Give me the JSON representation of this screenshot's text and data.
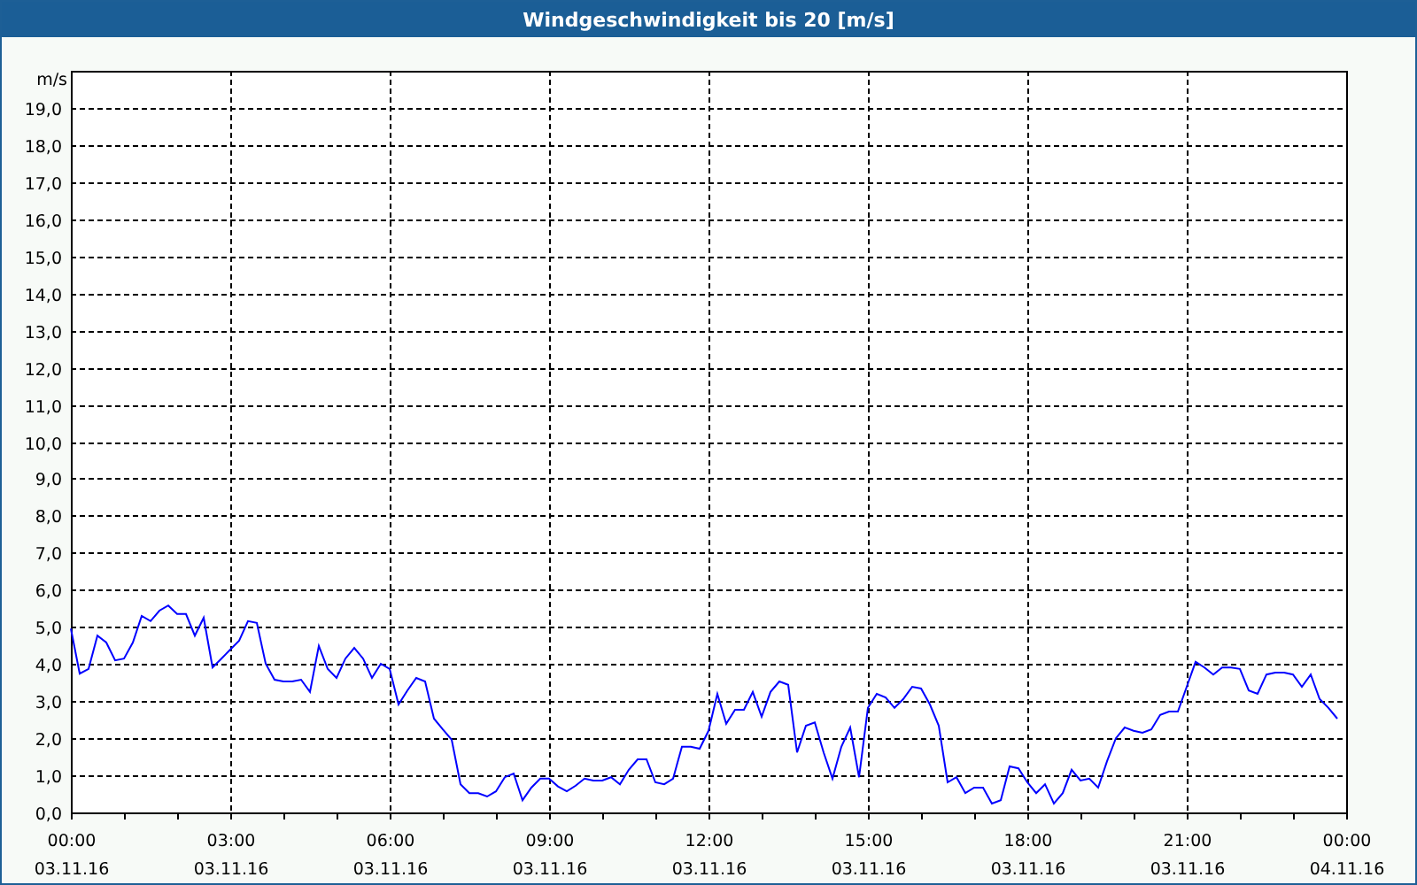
{
  "window": {
    "title": "Windgeschwindigkeit bis 20 [m/s]"
  },
  "chart": {
    "chart_data": {
      "type": "line",
      "grid": true,
      "ylabel": "m/s",
      "ylim": [
        0,
        20
      ],
      "yticks": [
        {
          "value": 0,
          "label": "0,0"
        },
        {
          "value": 1,
          "label": "1,0"
        },
        {
          "value": 2,
          "label": "2,0"
        },
        {
          "value": 3,
          "label": "3,0"
        },
        {
          "value": 4,
          "label": "4,0"
        },
        {
          "value": 5,
          "label": "5,0"
        },
        {
          "value": 6,
          "label": "6,0"
        },
        {
          "value": 7,
          "label": "7,0"
        },
        {
          "value": 8,
          "label": "8,0"
        },
        {
          "value": 9,
          "label": "9,0"
        },
        {
          "value": 10,
          "label": "10,0"
        },
        {
          "value": 11,
          "label": "11,0"
        },
        {
          "value": 12,
          "label": "12,0"
        },
        {
          "value": 13,
          "label": "13,0"
        },
        {
          "value": 14,
          "label": "14,0"
        },
        {
          "value": 15,
          "label": "15,0"
        },
        {
          "value": 16,
          "label": "16,0"
        },
        {
          "value": 17,
          "label": "17,0"
        },
        {
          "value": 18,
          "label": "18,0"
        },
        {
          "value": 19,
          "label": "19,0"
        }
      ],
      "categories": [
        "00:00\n03.11.16",
        null,
        null,
        null,
        null,
        null,
        null,
        null,
        null,
        null,
        null,
        null,
        null,
        null,
        null,
        null,
        null,
        null,
        "03:00\n03.11.16",
        null,
        null,
        null,
        null,
        null,
        null,
        null,
        null,
        null,
        null,
        null,
        null,
        null,
        null,
        null,
        null,
        null,
        "06:00\n03.11.16",
        null,
        null,
        null,
        null,
        null,
        null,
        null,
        null,
        null,
        null,
        null,
        null,
        null,
        null,
        null,
        null,
        null,
        "09:00\n03.11.16",
        null,
        null,
        null,
        null,
        null,
        null,
        null,
        null,
        null,
        null,
        null,
        null,
        null,
        null,
        null,
        null,
        null,
        "12:00\n03.11.16",
        null,
        null,
        null,
        null,
        null,
        null,
        null,
        null,
        null,
        null,
        null,
        null,
        null,
        null,
        null,
        null,
        null,
        "15:00\n03.11.16",
        null,
        null,
        null,
        null,
        null,
        null,
        null,
        null,
        null,
        null,
        null,
        null,
        null,
        null,
        null,
        null,
        null,
        "18:00\n03.11.16",
        null,
        null,
        null,
        null,
        null,
        null,
        null,
        null,
        null,
        null,
        null,
        null,
        null,
        null,
        null,
        null,
        null,
        "21:00\n03.11.16",
        null,
        null,
        null,
        null,
        null,
        null,
        null,
        null,
        null,
        null,
        null,
        null,
        null,
        null,
        null,
        null,
        null,
        "00:00\n04.11.16"
      ],
      "series": [
        {
          "color": "#0000ff",
          "values": [
            4.96,
            3.74,
            3.87,
            4.77,
            4.58,
            4.1,
            4.15,
            4.58,
            5.3,
            5.16,
            5.44,
            5.58,
            5.35,
            5.35,
            4.77,
            5.25,
            3.91,
            4.15,
            4.39,
            4.63,
            5.16,
            5.11,
            4.01,
            3.58,
            3.53,
            3.53,
            3.58,
            3.25,
            4.49,
            3.87,
            3.63,
            4.15,
            4.44,
            4.15,
            3.63,
            4.01,
            3.87,
            2.91,
            3.29,
            3.63,
            3.53,
            2.53,
            2.24,
            1.96,
            0.76,
            0.52,
            0.52,
            0.43,
            0.57,
            0.95,
            1.05,
            0.33,
            0.67,
            0.91,
            0.91,
            0.7,
            0.57,
            0.72,
            0.91,
            0.86,
            0.86,
            0.95,
            0.76,
            1.15,
            1.43,
            1.43,
            0.81,
            0.76,
            0.91,
            1.77,
            1.77,
            1.72,
            2.2,
            3.2,
            2.39,
            2.77,
            2.77,
            3.25,
            2.58,
            3.25,
            3.53,
            3.44,
            1.62,
            2.34,
            2.43,
            1.62,
            0.91,
            1.77,
            2.29,
            0.95,
            2.82,
            3.2,
            3.1,
            2.82,
            3.06,
            3.39,
            3.34,
            2.91,
            2.34,
            0.81,
            0.95,
            0.52,
            0.67,
            0.67,
            0.24,
            0.33,
            1.24,
            1.19,
            0.81,
            0.52,
            0.76,
            0.24,
            0.52,
            1.15,
            0.86,
            0.91,
            0.67,
            1.38,
            2.0,
            2.29,
            2.2,
            2.15,
            2.24,
            2.63,
            2.72,
            2.72,
            3.39,
            4.06,
            3.91,
            3.72,
            3.91,
            3.91,
            3.87,
            3.29,
            3.2,
            3.72,
            3.77,
            3.77,
            3.72,
            3.39,
            3.72,
            3.06,
            2.82,
            2.53,
            null
          ]
        }
      ]
    }
  }
}
